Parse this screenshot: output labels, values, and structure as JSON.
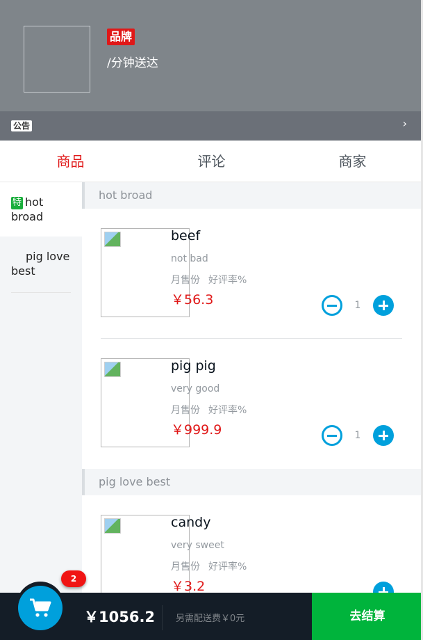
{
  "header": {
    "brand_badge": "品牌",
    "delivery_text": "/分钟送达",
    "notice_tag": "公告",
    "notice_arrow": "›"
  },
  "tabs": [
    {
      "label": "商品",
      "active": true
    },
    {
      "label": "评论",
      "active": false
    },
    {
      "label": "商家",
      "active": false
    }
  ],
  "menu": [
    {
      "special_tag": "特",
      "label": "hot broad"
    },
    {
      "label": "pig love best"
    }
  ],
  "sections": [
    {
      "title": "hot broad",
      "foods": [
        {
          "name": "beef",
          "description": "not bad",
          "sales_label": "月售份",
          "rating_label": "好评率%",
          "price": "￥56.3",
          "count": "1"
        },
        {
          "name": "pig pig",
          "description": "very good",
          "sales_label": "月售份",
          "rating_label": "好评率%",
          "price": "￥999.9",
          "count": "1"
        }
      ]
    },
    {
      "title": "pig love best",
      "foods": [
        {
          "name": "candy",
          "description": "very sweet",
          "sales_label": "月售份",
          "rating_label": "好评率%",
          "price": "￥3.2"
        }
      ]
    }
  ],
  "cart": {
    "badge_count": "2",
    "total": "￥1056.2",
    "delivery_fee": "另需配送费￥0元",
    "pay_label": "去结算",
    "icon": "cart-icon"
  },
  "colors": {
    "accent": "#e01818",
    "button_blue": "#00a0dc",
    "pay_green": "#00b43c",
    "header_bg": "#7f858a",
    "cart_bg": "#141d27"
  }
}
